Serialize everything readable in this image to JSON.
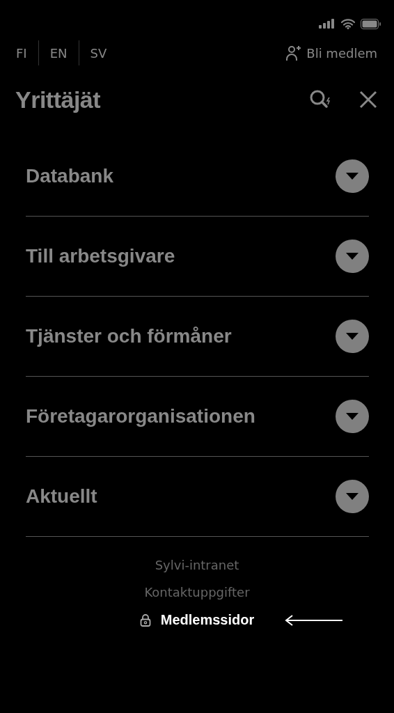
{
  "languages": [
    {
      "label": "FI"
    },
    {
      "label": "EN"
    },
    {
      "label": "SV"
    }
  ],
  "join_link": {
    "label": "Bli medlem"
  },
  "brand": {
    "title": "Yrittäjät"
  },
  "menu": [
    {
      "label": "Databank",
      "expanded": false
    },
    {
      "label": "Till arbetsgivare",
      "expanded": false
    },
    {
      "label": "Tjänster och förmåner",
      "expanded": false
    },
    {
      "label": "Företagarorganisationen",
      "expanded": false
    },
    {
      "label": "Aktuellt",
      "expanded": false
    }
  ],
  "footer_links": [
    {
      "label": "Sylvi-intranet",
      "kind": "plain",
      "highlighted": false
    },
    {
      "label": "Kontaktuppgifter",
      "kind": "plain",
      "highlighted": false
    },
    {
      "label": "Medlemssidor",
      "kind": "locked",
      "highlighted": true
    }
  ]
}
